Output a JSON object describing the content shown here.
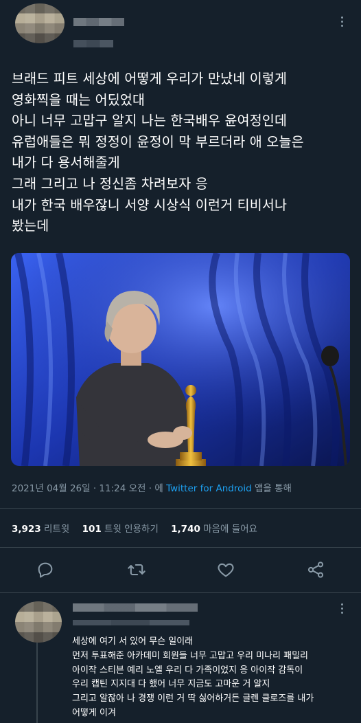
{
  "tweet": {
    "text_lines": [
      "브래드 피트 세상에 어떻게 우리가 만났네 이렇게",
      "영화찍을 때는 어딨었대",
      "아니 너무 고맙구 알지 나는 한국배우 윤여정인데",
      "유럽애들은 뭐 정정이 윤정이 막 부르더라 애 오늘은",
      "내가 다 용서해줄게",
      "그래 그리고 나 정신좀 차려보자 응",
      "내가 한국 배우잖니 서양 시상식 이런거 티비서나",
      "봤는데"
    ],
    "meta": {
      "datetime": "2021년 04월 26일 · 11:24 오전 · 에 ",
      "source": "Twitter for Android",
      "suffix": " 앱을 통해"
    },
    "stats": {
      "retweets": "3,923",
      "retweets_label": "리트윗",
      "quotes": "101",
      "quotes_label": "트윗 인용하기",
      "likes": "1,740",
      "likes_label": "마음에 들어요"
    }
  },
  "reply": {
    "text_lines": [
      "세상에 여기 서 있어 무슨 일이래",
      "먼저 투표해준 아카데미 회원들 너무 고맙고 우리 미나리 패밀리",
      "아이작 스티븐 예리 노엘 우리 다 가족이었지 응 아이작 감독이",
      "우리 캡틴 지지대 다 했어 너무 지금도 고마운 거 알지",
      "그리고 알잖아 나 경쟁 이런 거 딱 싫어하거든 글렌 클로즈를 내가",
      "어떻게 이겨"
    ]
  },
  "colors": {
    "background": "#15202b",
    "text": "#ffffff",
    "secondary": "#8899a6",
    "link": "#1da1f2",
    "divider": "#38444d"
  },
  "icons": [
    "more-icon",
    "reply-icon",
    "retweet-icon",
    "like-icon",
    "share-icon"
  ]
}
